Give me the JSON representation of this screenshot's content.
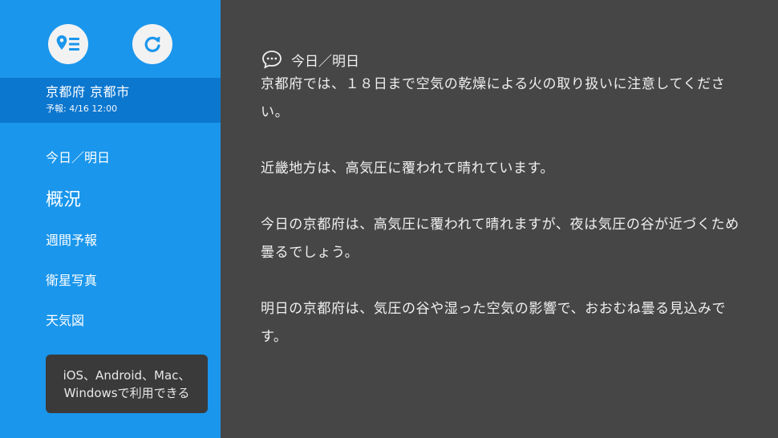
{
  "sidebar": {
    "location": "京都府 京都市",
    "forecast_time": "予報: 4/16 12:00",
    "nav": [
      {
        "label": "今日／明日"
      },
      {
        "label": "概況"
      },
      {
        "label": "週間予報"
      },
      {
        "label": "衛星写真"
      },
      {
        "label": "天気図"
      }
    ],
    "promo_line1": "iOS、Android、Mac、",
    "promo_line2": "Windowsで利用できる"
  },
  "main": {
    "heading": "今日／明日",
    "paragraphs": [
      "京都府では、１８日まで空気の乾燥による火の取り扱いに注意してください。",
      "近畿地方は、高気圧に覆われて晴れています。",
      "今日の京都府は、高気圧に覆われて晴れますが、夜は気圧の谷が近づくため曇るでしょう。",
      "明日の京都府は、気圧の谷や湿った空気の影響で、おおむね曇る見込みです。"
    ]
  },
  "icons": {
    "list_button": "location-list-icon",
    "refresh_button": "refresh-icon",
    "heading": "speech-bubble-icon"
  },
  "colors": {
    "sidebar": "#1a96ec",
    "location_band": "#0c77cf",
    "main_background": "#464646",
    "promo_background": "#3a3a3a",
    "icon_accent": "#1a96ec"
  }
}
